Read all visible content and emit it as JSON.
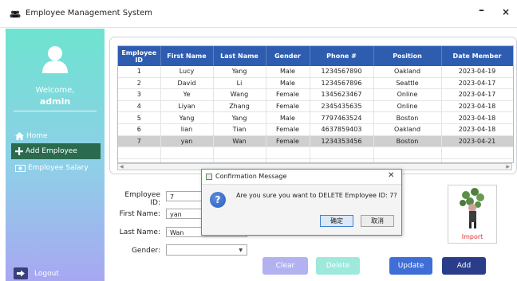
{
  "window": {
    "title": "Employee Management System",
    "minimize": "–",
    "close": "×"
  },
  "sidebar": {
    "welcome": "Welcome,",
    "username": "admin",
    "nav": [
      {
        "label": "Home",
        "icon": "home-icon",
        "active": false
      },
      {
        "label": "Add Employee",
        "icon": "plus-icon",
        "active": true
      },
      {
        "label": "Employee Salary",
        "icon": "money-icon",
        "active": false
      }
    ],
    "logout": "Logout"
  },
  "table": {
    "columns": [
      "Employee ID",
      "First Name",
      "Last Name",
      "Gender",
      "Phone #",
      "Position",
      "Date Member"
    ],
    "rows": [
      [
        "1",
        "Lucy",
        "Yang",
        "Male",
        "1234567890",
        "Oakland",
        "2023-04-19"
      ],
      [
        "2",
        "David",
        "Li",
        "Male",
        "1234567896",
        "Seattle",
        "2023-04-17"
      ],
      [
        "3",
        "Ye",
        "Wang",
        "Female",
        "1345623467",
        "Online",
        "2023-04-17"
      ],
      [
        "4",
        "Liyan",
        "Zhang",
        "Female",
        "2345435635",
        "Online",
        "2023-04-18"
      ],
      [
        "5",
        "Yang",
        "Yang",
        "Male",
        "7797463524",
        "Boston",
        "2023-04-18"
      ],
      [
        "6",
        "lian",
        "Tian",
        "Female",
        "4637859403",
        "Oakland",
        "2023-04-18"
      ],
      [
        "7",
        "yan",
        "Wan",
        "Female",
        "1234353456",
        "Boston",
        "2023-04-21"
      ]
    ],
    "selected_row": 6
  },
  "form": {
    "employee_id_label": "Employee ID:",
    "employee_id_value": "7",
    "first_name_label": "First Name:",
    "first_name_value": "yan",
    "last_name_label": "Last Name:",
    "last_name_value": "Wan",
    "gender_label": "Gender:",
    "gender_value": ""
  },
  "buttons": {
    "clear": "Clear",
    "delete": "Delete",
    "update": "Update",
    "add": "Add",
    "import": "Import"
  },
  "dialog": {
    "title": "Confirmation Message",
    "message": "Are you sure you want to DELETE Employee ID: 7?",
    "ok": "确定",
    "cancel": "取消"
  },
  "colors": {
    "table_header": "#2e5db0",
    "nav_active": "#2a6b4f",
    "btn_clear": "#b2b2f0",
    "btn_delete": "#9ee8dc",
    "btn_update": "#3e6ed6",
    "btn_add": "#2a3d8a",
    "import_text": "#dd3333"
  }
}
